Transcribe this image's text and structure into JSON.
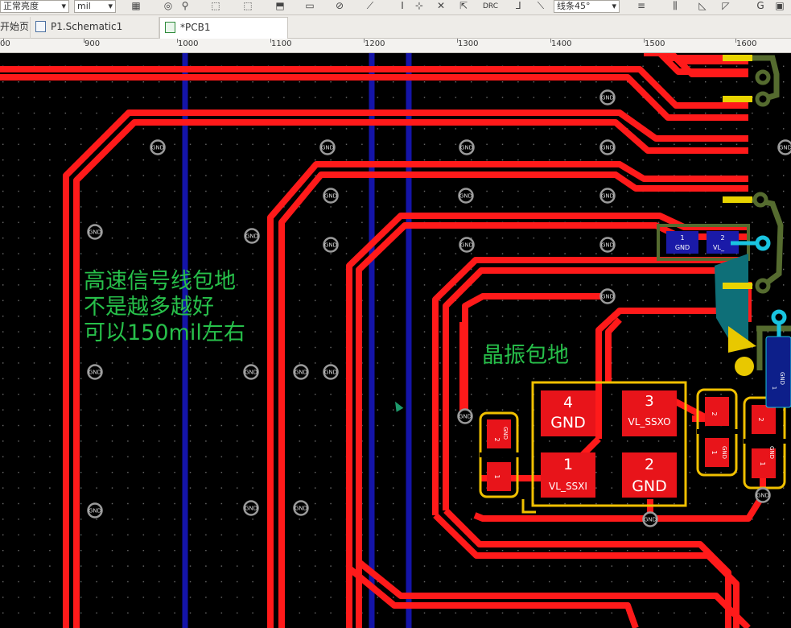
{
  "toolbar": {
    "view_mode": "正常亮度",
    "unit": "mil",
    "drc": "DRC",
    "line_style": "线条45°"
  },
  "tabs": [
    {
      "label": "开始页"
    },
    {
      "label": "P1.Schematic1"
    },
    {
      "label": "*PCB1"
    }
  ],
  "ruler": {
    "labels": [
      "900",
      "1000",
      "1100",
      "1200",
      "1300",
      "1400",
      "1500",
      "1600"
    ],
    "partial_left": "00"
  },
  "annotations": {
    "routing_note": [
      "高速信号线包地",
      "不是越多越好",
      "可以150mil左右"
    ],
    "crystal_note": "晶振包地"
  },
  "crystal": {
    "pad4_num": "4",
    "pad4_net": "GND",
    "pad3_num": "3",
    "pad3_net": "VL_SSXO",
    "pad1_num": "1",
    "pad1_net": "VL_SSXI",
    "pad2_num": "2",
    "pad2_net": "GND"
  },
  "caps": {
    "c_left_top": "2",
    "c_left_top_net": "GND",
    "c_left_bot": "1",
    "c_mid_top": "2",
    "c_mid_bot": "1",
    "c_mid_net": "GND",
    "c_right_top": "2",
    "c_right_bot": "1",
    "c_right_net": "GND",
    "top_comp_pad": "1",
    "top_comp_net": "GND",
    "top_comp_pad2": "2",
    "top_comp_net2": "VL_",
    "edge_comp_net": "GND",
    "edge_comp_pad": "1"
  },
  "via_label": "GND",
  "colors": {
    "background": "#000000",
    "top_trace": "#ff1a1a",
    "bottom_trace": "#1414a8",
    "silkscreen": "#f0c000",
    "annotation": "#27c04a",
    "via": "#9a9a9a"
  }
}
